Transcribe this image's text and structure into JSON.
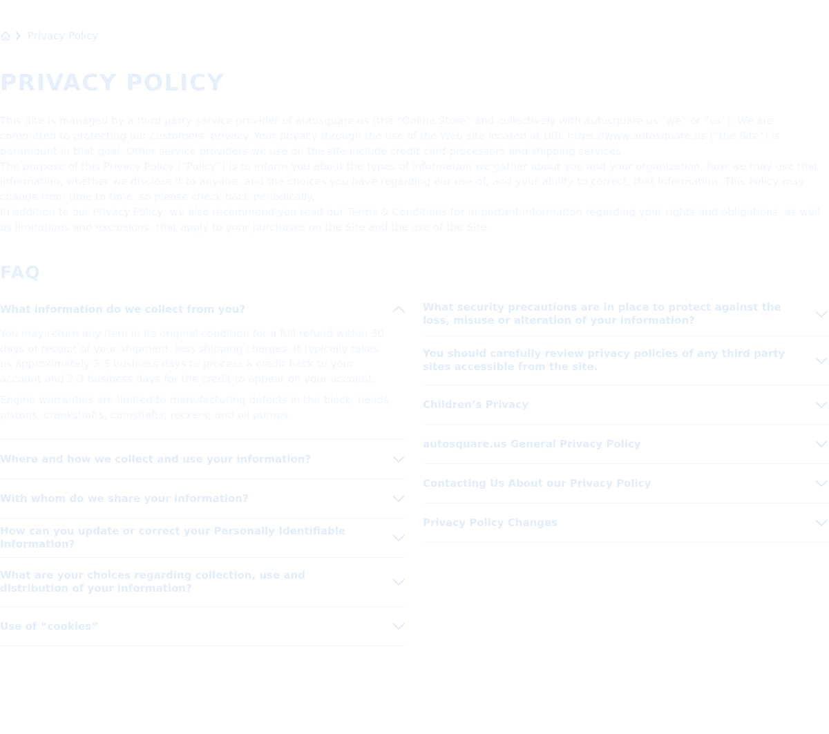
{
  "breadcrumb": {
    "home_icon": "home-icon",
    "separator_icon": "chevron-right-icon",
    "current": "Privacy Policy"
  },
  "title": "PRIVACY POLICY",
  "intro": [
    "This Site is managed by a third party service provider of autosquare.us (the “Online Store” and collectively with autosquare.us “we” or “us”). We are committed to protecting our customers’ privacy. Your privacy through the use of the Web site located at URL https://www.autosquare.us (“the Site”) is paramount in that goal. Other service providers we use on the site include credit card processors and shipping services.",
    "The purpose of this Privacy Policy (“Policy”) is to inform you about the types of information we gather about you and your organization, how we may use that information, whether we disclose it to anyone, and the choices you have regarding our use of, and your ability to correct, that information. This Policy may change from time to time, so please check back periodically.",
    "In addition to our Privacy Policy, we also recommend you read our Terms & Conditions for important information regarding your rights and obligations, as well as limitations and exclusions, that apply to your purchases on the Site and the use of the Site."
  ],
  "faq_heading": "FAQ",
  "faq_left": [
    {
      "question": "What information do we collect from you?",
      "expanded": true,
      "answer": [
        "You may return any item in its original condition for a full refund within 30 days of receipt of your shipment, less shipping charges. It typically takes us approximately 3-5 business days to process a credit back to your account and 2-3 business days for the credit to appear on your account.",
        "Engine warranties are limited to manufacturing defects in the block, heads, pistons, crankshafts, camshafts, rockers, and oil pumps."
      ]
    },
    {
      "question": "Where and how we collect and use your information?",
      "expanded": false
    },
    {
      "question": "With whom do we share your information?",
      "expanded": false
    },
    {
      "question": "How can you update or correct your Personally Identifiable Information?",
      "expanded": false
    },
    {
      "question": "What are your choices regarding collection, use and distribution of your information?",
      "expanded": false
    },
    {
      "question": " Use of “cookies”",
      "expanded": false
    }
  ],
  "faq_right": [
    {
      "question": "What security precautions are in place to protect against the loss, misuse or alteration of your information?",
      "expanded": false
    },
    {
      "question": "You should carefully review privacy policies of any third party sites accessible from the site.",
      "expanded": false
    },
    {
      "question": "Children’s Privacy",
      "expanded": false
    },
    {
      "question": "autosquare.us General Privacy Policy",
      "expanded": false
    },
    {
      "question": "Contacting Us About our Privacy Policy",
      "expanded": false
    },
    {
      "question": "Privacy Policy Changes",
      "expanded": false
    }
  ],
  "icons": {
    "expanded": "chevron-up-icon",
    "collapsed": "chevron-down-icon"
  },
  "colors": {
    "accent": "#e2edfb",
    "text": "#eef5fd",
    "divider": "#f2f6fb"
  }
}
